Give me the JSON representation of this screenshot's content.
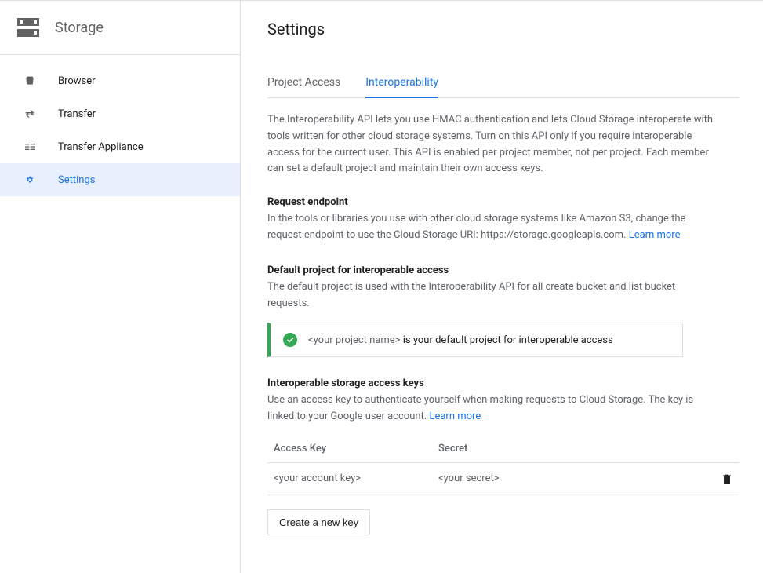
{
  "product": {
    "name": "Storage"
  },
  "nav": [
    {
      "label": "Browser",
      "icon": "bucket"
    },
    {
      "label": "Transfer",
      "icon": "transfer"
    },
    {
      "label": "Transfer Appliance",
      "icon": "appliance"
    },
    {
      "label": "Settings",
      "icon": "gear",
      "active": true
    }
  ],
  "page": {
    "title": "Settings"
  },
  "tabs": [
    {
      "label": "Project Access",
      "active": false
    },
    {
      "label": "Interoperability",
      "active": true
    }
  ],
  "intro": "The Interoperability API lets you use HMAC authentication and lets Cloud Storage interoperate with tools written for other cloud storage systems. Turn on this API only if you require interoperable access for the current user. This API is enabled per project member, not per project. Each member can set a default project and maintain their own access keys.",
  "endpoint": {
    "heading": "Request endpoint",
    "text": "In the tools or libraries you use with other cloud storage systems like Amazon S3, change the request endpoint to use the Cloud Storage URI: https://storage.googleapis.com. ",
    "learn": "Learn more"
  },
  "defaultProject": {
    "heading": "Default project for interoperable access",
    "text": "The default project is used with the Interoperability API for all create bucket and list bucket requests.",
    "banner": {
      "placeholder": "<your project name>",
      "suffix": " is your default project for interoperable access"
    }
  },
  "keys": {
    "heading": "Interoperable storage access keys",
    "text": "Use an access key to authenticate yourself when making requests to Cloud Storage. The key is linked to your Google user account. ",
    "learn": "Learn more",
    "columns": {
      "key": "Access Key",
      "secret": "Secret"
    },
    "rows": [
      {
        "key": "<your account key>",
        "secret": "<your secret>"
      }
    ],
    "createBtn": "Create a new key"
  }
}
